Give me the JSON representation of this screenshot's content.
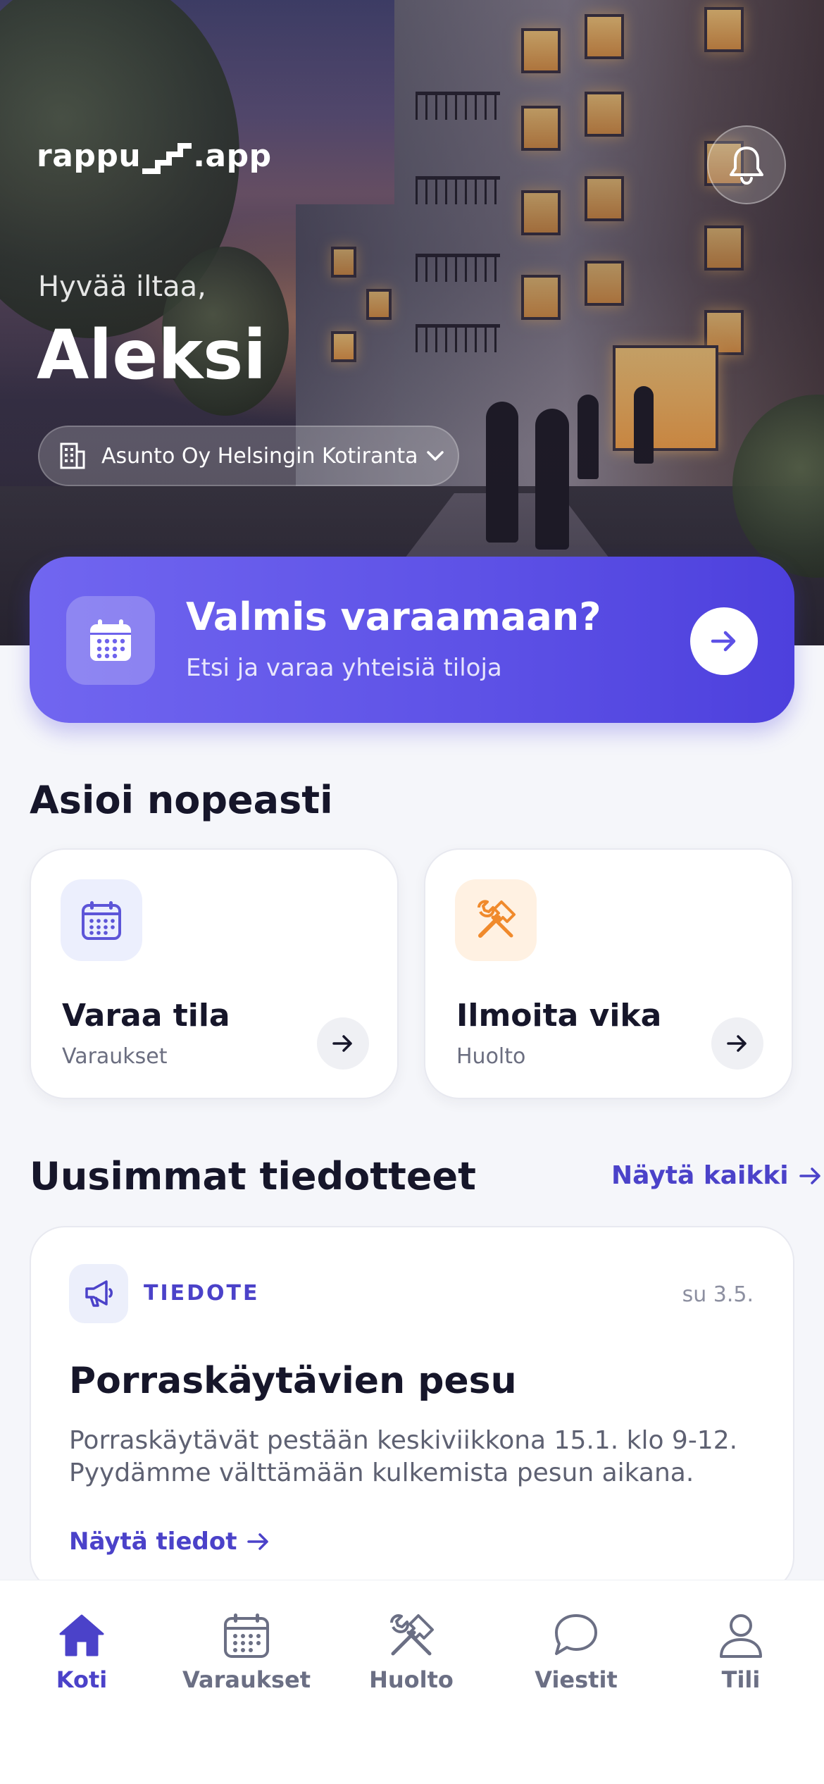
{
  "app": {
    "logo_left": "rappu",
    "logo_right": ".app"
  },
  "header": {
    "greeting": "Hyvää iltaa,",
    "user_name": "Aleksi",
    "building": "Asunto Oy Helsingin Kotiranta",
    "building_icon": "building-icon",
    "notification_icon": "bell-icon"
  },
  "cta": {
    "title": "Valmis varaamaan?",
    "subtitle": "Etsi ja varaa yhteisiä tiloja",
    "icon": "calendar-icon"
  },
  "quick_actions": {
    "title": "Asioi nopeasti",
    "items": [
      {
        "title": "Varaa tila",
        "subtitle": "Varaukset",
        "icon": "calendar-icon",
        "accent": "#5d55d8",
        "icon_bg": "#eceffd"
      },
      {
        "title": "Ilmoita vika",
        "subtitle": "Huolto",
        "icon": "tools-icon",
        "accent": "#f08a2c",
        "icon_bg": "#fff1e2"
      }
    ]
  },
  "announcements": {
    "title": "Uusimmat tiedotteet",
    "see_all": "Näytä kaikki",
    "items": [
      {
        "tag": "TIEDOTE",
        "date": "su 3.5.",
        "title": "Porraskäytävien pesu",
        "body": "Porraskäytävät pestään keskiviikkona 15.1. klo 9-12. Pyydämme välttämään kulkemista pesun aikana.",
        "link": "Näytä tiedot",
        "icon": "megaphone-icon"
      }
    ]
  },
  "tabbar": {
    "active": "Koti",
    "items": [
      {
        "label": "Koti",
        "icon": "home-icon"
      },
      {
        "label": "Varaukset",
        "icon": "calendar-icon"
      },
      {
        "label": "Huolto",
        "icon": "tools-icon"
      },
      {
        "label": "Viestit",
        "icon": "chat-icon"
      },
      {
        "label": "Tili",
        "icon": "user-icon"
      }
    ]
  },
  "colors": {
    "primary": "#4b42c9",
    "cta_gradient_start": "#7166f0",
    "cta_gradient_end": "#4d40dd",
    "accent_orange": "#f08a2c",
    "background": "#f5f6fa"
  }
}
